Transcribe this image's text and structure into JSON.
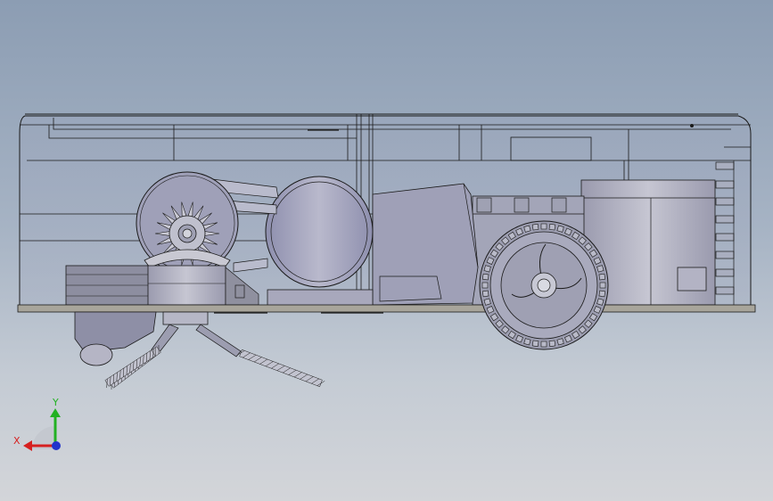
{
  "app": {
    "view": "cad-model-viewport"
  },
  "triad": {
    "x_label": "X",
    "y_label": "Y",
    "x_color": "#d62020",
    "y_color": "#22b122",
    "z_color": "#2233cc"
  },
  "colors": {
    "background_top": "#8c9db3",
    "background_bottom": "#d3d5d9",
    "outline": "#1a1a1a",
    "body_fill": "#9ea8bd",
    "part_fill": "#a9a9bb",
    "metal_fill": "#b7b7c4"
  },
  "icons": {
    "triad": "coordinate-triad-icon"
  }
}
